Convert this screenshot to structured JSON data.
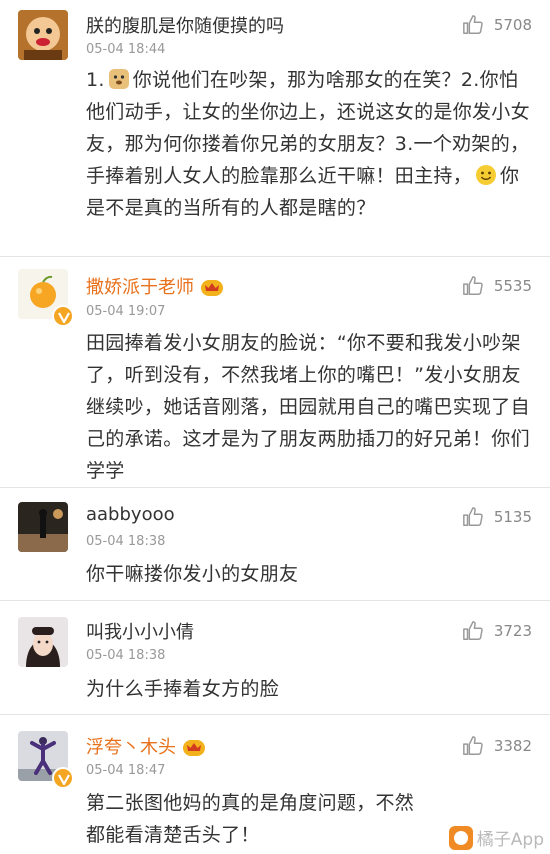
{
  "comments": [
    {
      "username": "朕的腹肌是你随便摸的吗",
      "time": "05-04 18:44",
      "likes": "5708",
      "avatar_icon": "cartoon-face-avatar",
      "text_part1": "1.",
      "emoji1": "doge-emoji",
      "text_part2": "你说他们在吵架，那为啥那女的在笑？2.你怕他们动手，让女的坐你边上，还说这女的是你发小女友，那为何你搂着你兄弟的女朋友？3.一个劝架的，手捧着别人女人的脸靠那么近干嘛！田主持，",
      "emoji2": "smile-emoji",
      "text_part3": "你是不是真的当所有的人都是瞎的？"
    },
    {
      "username": "撒娇派于老师",
      "time": "05-04 19:07",
      "likes": "5535",
      "avatar_icon": "orange-fruit-avatar",
      "verified": true,
      "vip": true,
      "text": "田园捧着发小女朋友的脸说：“你不要和我发小吵架了，听到没有，不然我堵上你的嘴巴！”发小女朋友继续吵，她话音刚落，田园就用自己的嘴巴实现了自己的承诺。这才是为了朋友两肋插刀的好兄弟！你们学学"
    },
    {
      "username": "aabbyooo",
      "time": "05-04 18:38",
      "likes": "5135",
      "avatar_icon": "street-photo-avatar",
      "text": "你干嘛搂你发小的女朋友"
    },
    {
      "username": "叫我小小小倩",
      "time": "05-04 18:38",
      "likes": "3723",
      "avatar_icon": "girl-selfie-avatar",
      "text": "为什么手捧着女方的脸"
    },
    {
      "username": "浮夸丶木头",
      "time": "05-04 18:47",
      "likes": "3382",
      "avatar_icon": "dancer-photo-avatar",
      "verified": true,
      "vip": true,
      "text": "第二张图他妈的真的是角度问题，不然都能看清楚舌头了！"
    }
  ],
  "watermark": {
    "text": "橘子App"
  },
  "colors": {
    "vip_name": "#e8711c",
    "verified_badge": "#f4a623",
    "meta": "#999999"
  }
}
